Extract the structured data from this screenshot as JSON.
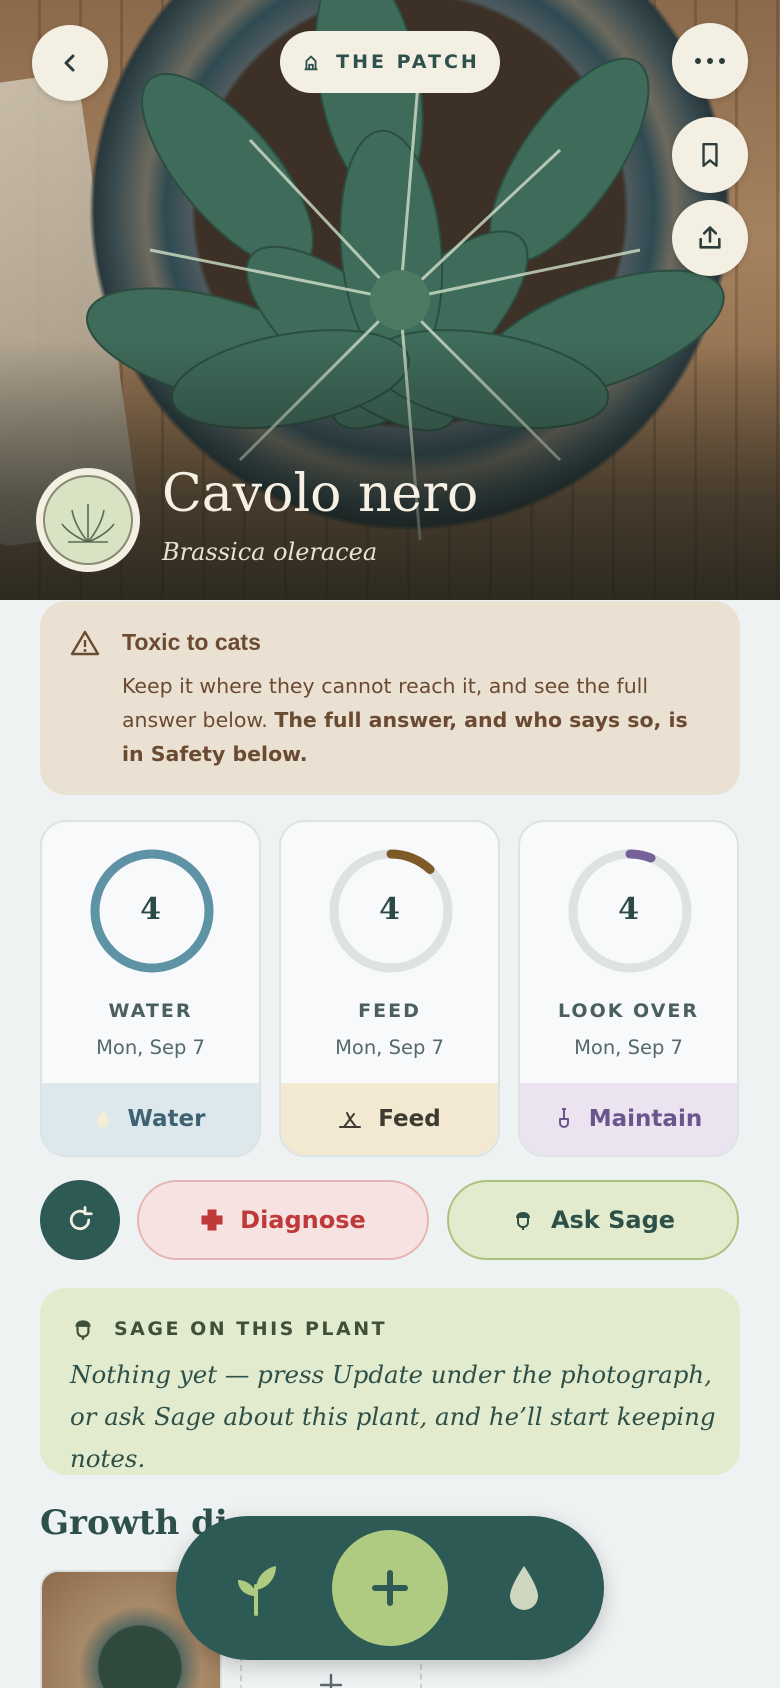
{
  "header": {
    "garden_label": "THE PATCH"
  },
  "plant": {
    "common_name": "Cavolo nero",
    "latin_name": "Brassica oleracea"
  },
  "warning": {
    "title": "Toxic to cats",
    "body": "Keep it where they cannot reach it, and see the full answer below.",
    "body_bold": "The full answer, and who says so, is in Safety below."
  },
  "schedule": [
    {
      "days": "4",
      "label": "WATER",
      "date": "Mon, Sep 7",
      "action": "Water",
      "progress": 1.0,
      "color": "#5e93a6",
      "action_bg": "#dde8ec",
      "action_color": "#3f6272"
    },
    {
      "days": "4",
      "label": "FEED",
      "date": "Mon, Sep 7",
      "action": "Feed",
      "progress": 0.12,
      "color": "#7d5a28",
      "action_bg": "#f3e9d2",
      "action_color": "#3d3a30"
    },
    {
      "days": "4",
      "label": "LOOK OVER",
      "date": "Mon, Sep 7",
      "action": "Maintain",
      "progress": 0.06,
      "color": "#76609a",
      "action_bg": "#ebe3ef",
      "action_color": "#6a568c"
    }
  ],
  "actions": {
    "diagnose": "Diagnose",
    "ask_sage": "Ask Sage"
  },
  "sage": {
    "heading": "SAGE ON THIS PLANT",
    "text": "Nothing yet — press Update under the photograph, or ask Sage about this plant, and he’ll start keeping notes."
  },
  "growth": {
    "title": "Growth di"
  },
  "colors": {
    "primary": "#2e5a55",
    "accent_green": "#afcb81",
    "warning_bg": "#ebe1d3",
    "sage_bg": "#e3ebcf",
    "diagnose_bg": "#f6e2e0",
    "diagnose_text": "#c0393a"
  },
  "icons": [
    "back-icon",
    "house-icon",
    "more-icon",
    "bookmark-icon",
    "share-icon",
    "warning-icon",
    "drop-icon",
    "fork-icon",
    "trowel-icon",
    "refresh-icon",
    "cross-icon",
    "sage-icon",
    "sprout-icon",
    "plus-icon"
  ]
}
